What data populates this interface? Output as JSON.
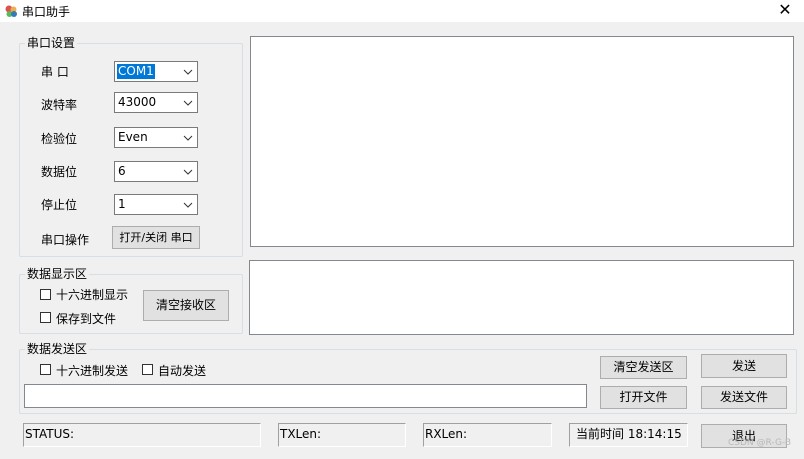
{
  "window": {
    "title": "串口助手",
    "close_glyph": "✕"
  },
  "serial_group": {
    "title": "串口设置",
    "port": {
      "label": "串 口",
      "value": "COM1"
    },
    "baud": {
      "label": "波特率",
      "value": "43000"
    },
    "parity": {
      "label": "检验位",
      "value": "Even"
    },
    "databits": {
      "label": "数据位",
      "value": "6"
    },
    "stopbits": {
      "label": "停止位",
      "value": "1"
    },
    "operation": {
      "label": "串口操作",
      "button": "打开/关闭 串口"
    }
  },
  "display_group": {
    "title": "数据显示区",
    "hex_display": "十六进制显示",
    "save_to_file": "保存到文件",
    "clear_button": "清空接收区"
  },
  "send_group": {
    "title": "数据发送区",
    "hex_send": "十六进制发送",
    "auto_send": "自动发送",
    "clear_send_button": "清空发送区",
    "open_file_button": "打开文件",
    "send_button": "发送",
    "send_file_button": "发送文件"
  },
  "status_bar": {
    "status": "STATUS:",
    "txlen": "TXLen:",
    "rxlen": "RXLen:",
    "time": "当前时间 18:14:15",
    "exit_button": "退出"
  },
  "watermark": "CSDN @R-G-B",
  "icons": [
    "app-icon",
    "close-icon",
    "chevron-down-icon",
    "checkbox-icon"
  ]
}
